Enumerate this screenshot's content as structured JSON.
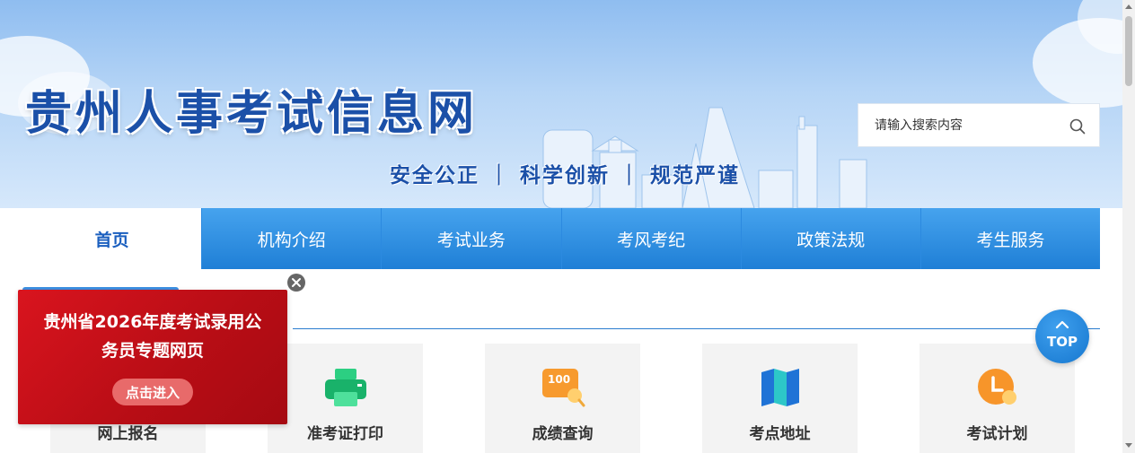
{
  "site": {
    "title": "贵州人事考试信息网",
    "slogan": "安全公正 ｜ 科学创新 ｜ 规范严谨"
  },
  "search": {
    "placeholder": "请输入搜索内容",
    "icon": "search-icon"
  },
  "nav": {
    "items": [
      {
        "label": "首页",
        "active": true
      },
      {
        "label": "机构介绍"
      },
      {
        "label": "考试业务"
      },
      {
        "label": "考风考纪"
      },
      {
        "label": "政策法规"
      },
      {
        "label": "考生服务"
      }
    ]
  },
  "services": [
    {
      "label": "网上报名",
      "icon": "register-icon"
    },
    {
      "label": "准考证打印",
      "icon": "printer-icon"
    },
    {
      "label": "成绩查询",
      "icon": "score-search-icon"
    },
    {
      "label": "考点地址",
      "icon": "map-icon"
    },
    {
      "label": "考试计划",
      "icon": "clock-icon"
    }
  ],
  "popup": {
    "title": "贵州省2026年度考试录用公务员专题网页",
    "button_label": "点击进入",
    "close_icon": "close-icon"
  },
  "back_to_top": {
    "label": "TOP",
    "icon": "chevron-up-icon"
  },
  "colors": {
    "brand_blue": "#1b50a8",
    "nav_blue": "#1f7fd6",
    "popup_red": "#c8101a"
  }
}
